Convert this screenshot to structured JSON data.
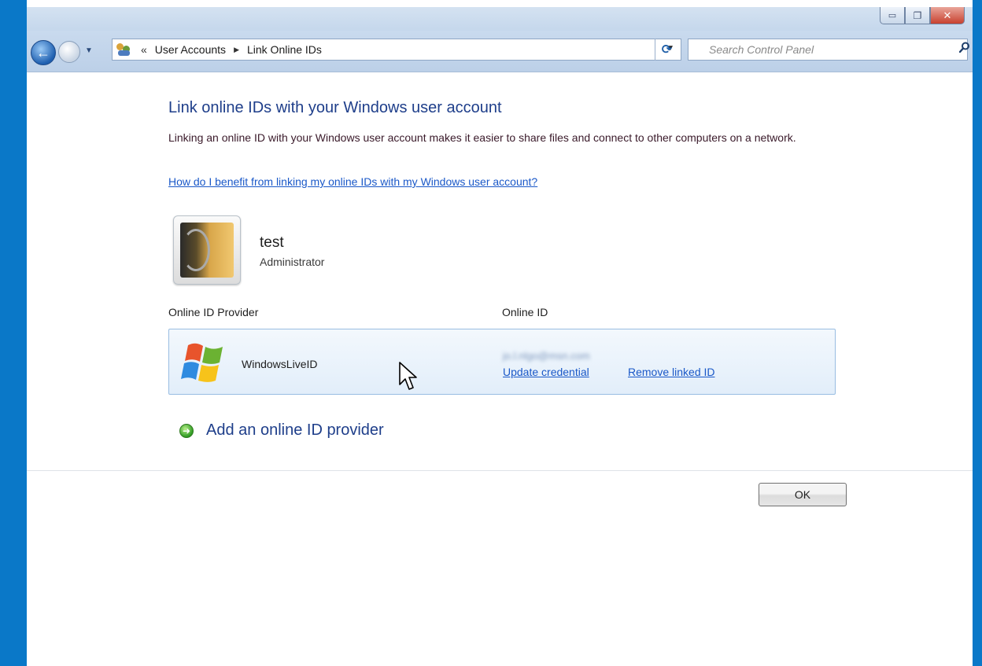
{
  "window": {
    "minimize_glyph": "▭",
    "restore_glyph": "❐",
    "close_glyph": "✕"
  },
  "navbar": {
    "back_glyph": "←",
    "breadcrumb_overflow": "«",
    "breadcrumbs": [
      "User Accounts",
      "Link Online IDs"
    ],
    "refresh_glyph": "⟳",
    "search_placeholder": "Search Control Panel"
  },
  "page": {
    "title": "Link online IDs with your Windows user account",
    "description": "Linking an online ID with your Windows user account makes it easier to share files and connect to other computers on a network.",
    "help_link": "How do I benefit from linking my online IDs with my Windows user account?"
  },
  "user": {
    "name": "test",
    "role": "Administrator"
  },
  "columns": {
    "provider": "Online ID Provider",
    "online_id": "Online ID"
  },
  "providers": [
    {
      "name": "WindowsLiveID",
      "online_id": "jo.l.nlgo@msn.com",
      "update_label": "Update credential",
      "remove_label": "Remove linked ID"
    }
  ],
  "add_provider": {
    "label": "Add an online ID provider",
    "icon": "arrow-right-icon"
  },
  "buttons": {
    "ok": "OK"
  }
}
